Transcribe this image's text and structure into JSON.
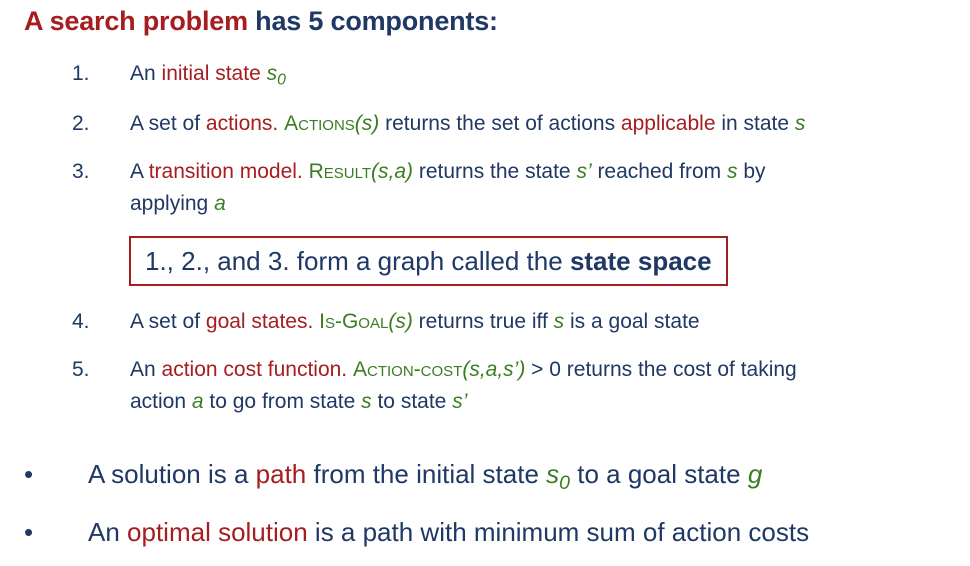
{
  "heading": {
    "part1": "A search problem",
    "part2": " has 5 components:"
  },
  "items": [
    {
      "num": "1.",
      "t1": "An ",
      "t2": "initial state",
      "t3": " ",
      "t4": "s",
      "t5": "0"
    },
    {
      "num": "2.",
      "t1": "A set of ",
      "t2": "actions.",
      "t3": " ",
      "t4": "Actions",
      "t5": "(s)",
      "t6": " returns the set of actions ",
      "t7": "applicable",
      "t8": " in state ",
      "t9": "s"
    },
    {
      "num": "3.",
      "t1": "A ",
      "t2": "transition model.",
      "t3": " ",
      "t4": "Result",
      "t5": "(s,a)",
      "t6": " returns the state ",
      "t7": "s’",
      "t8": " reached from ",
      "t9": "s",
      "t10": " by",
      "t11": "applying ",
      "t12": "a"
    },
    {
      "num": "4.",
      "t1": "A set of ",
      "t2": "goal states.",
      "t3": " ",
      "t4": "Is-Goal",
      "t5": "(s)",
      "t6": " returns true iff ",
      "t7": "s",
      "t8": " is a goal state"
    },
    {
      "num": "5.",
      "t1": "An ",
      "t2": "action cost function.",
      "t3": " ",
      "t4": "Action-cost",
      "t5": "(s,a,s’)",
      "t6": " > 0 returns the cost of taking",
      "t7": "action ",
      "t8": "a",
      "t9": " to go from state ",
      "t10": "s",
      "t11": " to state ",
      "t12": "s’"
    }
  ],
  "statespace": {
    "t1": "1., 2., and 3. form a graph called the ",
    "t2": "state space"
  },
  "bullets": [
    {
      "dot": "•",
      "t1": "A solution is a ",
      "t2": "path",
      "t3": " from the initial state ",
      "t4": "s",
      "t5": "0",
      "t6": " to a goal state ",
      "t7": "g"
    },
    {
      "dot": "•",
      "t1": "An ",
      "t2": "optimal solution",
      "t3": " is a path with minimum sum of action costs"
    }
  ],
  "colors": {
    "red": "#a51d20",
    "green": "#3a7d22",
    "navy": "#1f3864"
  }
}
